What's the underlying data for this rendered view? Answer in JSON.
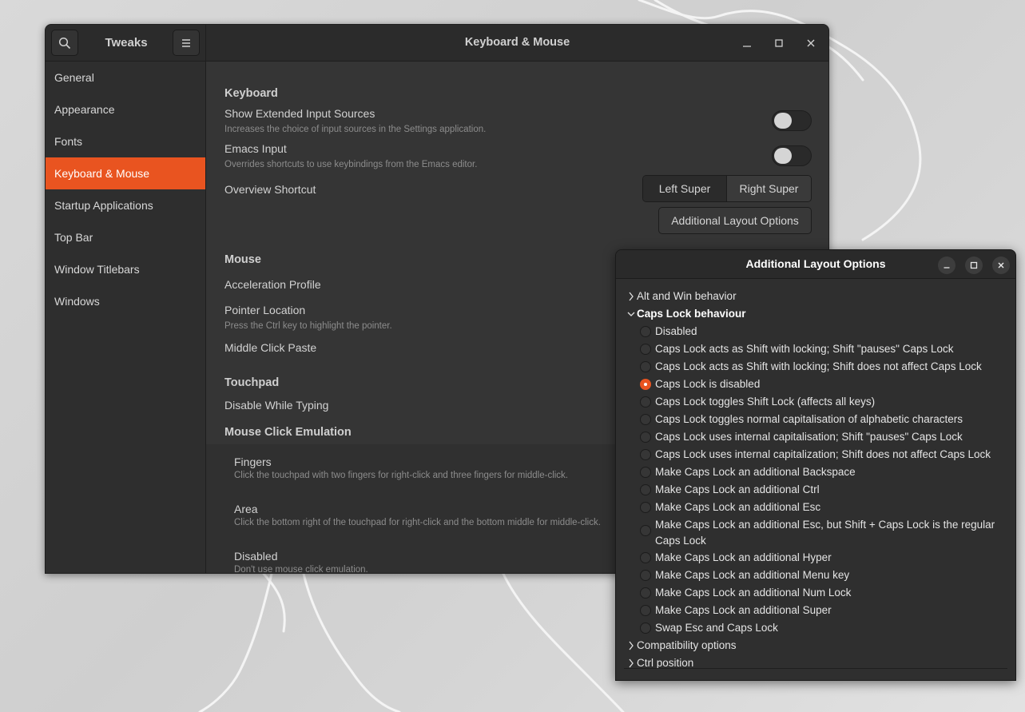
{
  "tweaks": {
    "app_title": "Tweaks",
    "window_title": "Keyboard & Mouse",
    "sidebar": {
      "items": [
        {
          "label": "General",
          "active": false
        },
        {
          "label": "Appearance",
          "active": false
        },
        {
          "label": "Fonts",
          "active": false
        },
        {
          "label": "Keyboard & Mouse",
          "active": true
        },
        {
          "label": "Startup Applications",
          "active": false
        },
        {
          "label": "Top Bar",
          "active": false
        },
        {
          "label": "Window Titlebars",
          "active": false
        },
        {
          "label": "Windows",
          "active": false
        }
      ]
    },
    "keyboard": {
      "title": "Keyboard",
      "extended_sources_label": "Show Extended Input Sources",
      "extended_sources_desc": "Increases the choice of input sources in the Settings application.",
      "extended_sources_on": false,
      "emacs_label": "Emacs Input",
      "emacs_desc": "Overrides shortcuts to use keybindings from the Emacs editor.",
      "emacs_on": false,
      "overview_label": "Overview Shortcut",
      "overview_left": "Left Super",
      "overview_right": "Right Super",
      "additional_button": "Additional Layout Options"
    },
    "mouse": {
      "title": "Mouse",
      "acceleration_label": "Acceleration Profile",
      "pointer_label": "Pointer Location",
      "pointer_desc": "Press the Ctrl key to highlight the pointer.",
      "middle_click_label": "Middle Click Paste"
    },
    "touchpad": {
      "title": "Touchpad",
      "disable_typing_label": "Disable While Typing"
    },
    "emulation": {
      "title": "Mouse Click Emulation",
      "options": [
        {
          "label": "Fingers",
          "desc": "Click the touchpad with two fingers for right-click and three fingers for middle-click."
        },
        {
          "label": "Area",
          "desc": "Click the bottom right of the touchpad for right-click and the bottom middle for middle-click."
        },
        {
          "label": "Disabled",
          "desc": "Don't use mouse click emulation."
        }
      ]
    }
  },
  "dialog": {
    "title": "Additional Layout Options",
    "categories_before": [
      {
        "label": "Alt and Win behavior"
      }
    ],
    "open_category": "Caps Lock behaviour",
    "options": [
      {
        "label": "Disabled",
        "selected": false
      },
      {
        "label": "Caps Lock acts as Shift with locking; Shift \"pauses\" Caps Lock",
        "selected": false
      },
      {
        "label": "Caps Lock acts as Shift with locking; Shift does not affect Caps Lock",
        "selected": false
      },
      {
        "label": "Caps Lock is disabled",
        "selected": true
      },
      {
        "label": "Caps Lock toggles Shift Lock (affects all keys)",
        "selected": false
      },
      {
        "label": "Caps Lock toggles normal capitalisation of alphabetic characters",
        "selected": false
      },
      {
        "label": "Caps Lock uses internal capitalisation; Shift \"pauses\" Caps Lock",
        "selected": false
      },
      {
        "label": "Caps Lock uses internal capitalization; Shift does not affect Caps Lock",
        "selected": false
      },
      {
        "label": "Make Caps Lock an additional Backspace",
        "selected": false
      },
      {
        "label": "Make Caps Lock an additional Ctrl",
        "selected": false
      },
      {
        "label": "Make Caps Lock an additional Esc",
        "selected": false
      },
      {
        "label": "Make Caps Lock an additional Esc, but Shift + Caps Lock is the regular Caps Lock",
        "selected": false
      },
      {
        "label": "Make Caps Lock an additional Hyper",
        "selected": false
      },
      {
        "label": "Make Caps Lock an additional Menu key",
        "selected": false
      },
      {
        "label": "Make Caps Lock an additional Num Lock",
        "selected": false
      },
      {
        "label": "Make Caps Lock an additional Super",
        "selected": false
      },
      {
        "label": "Swap Esc and Caps Lock",
        "selected": false
      }
    ],
    "categories_after": [
      {
        "label": "Compatibility options"
      },
      {
        "label": "Ctrl position"
      }
    ]
  },
  "colors": {
    "accent": "#e95420",
    "window_bg": "#353535",
    "sidebar_bg": "#2e2e2e"
  }
}
